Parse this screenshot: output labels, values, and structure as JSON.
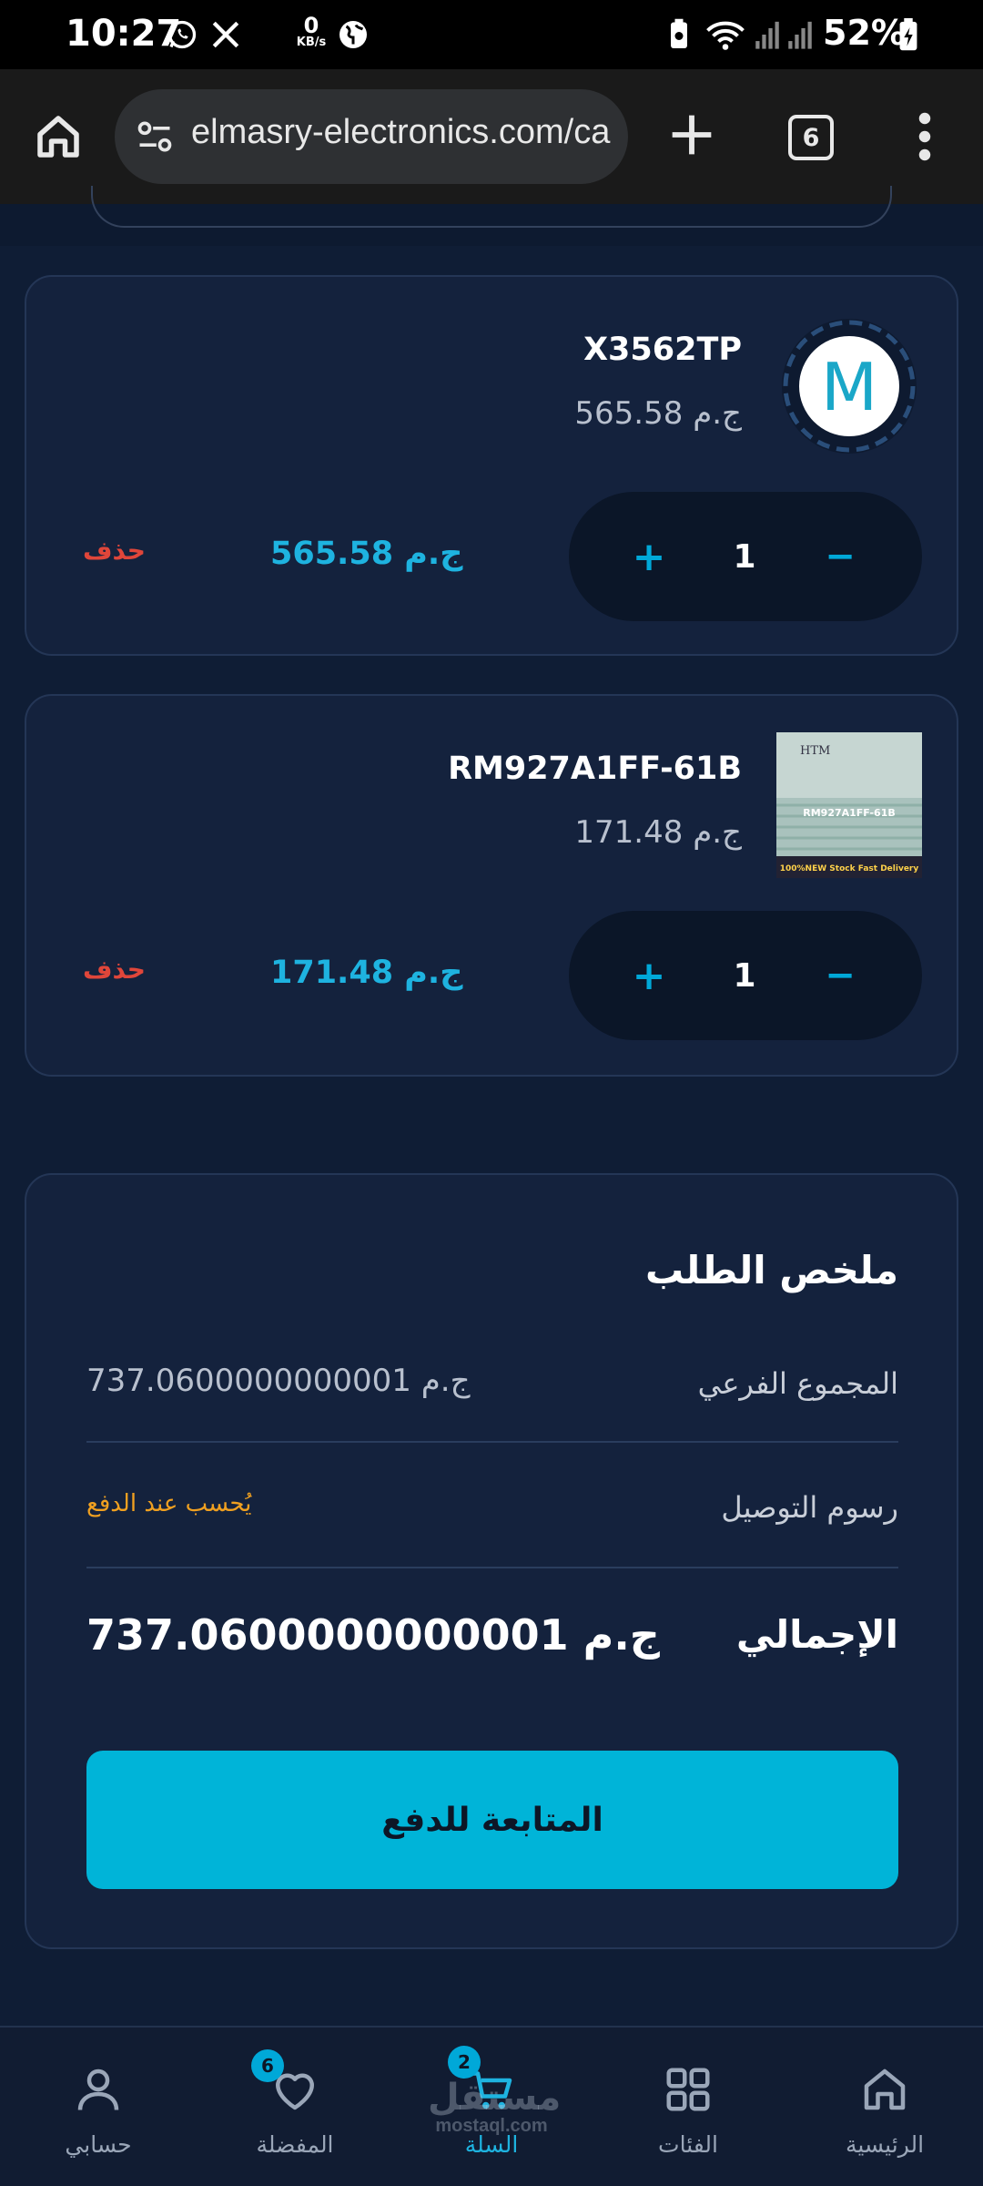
{
  "status_bar": {
    "time": "10:27",
    "net_speed_value": "0",
    "net_speed_unit": "KB/s",
    "battery": "52%"
  },
  "browser": {
    "url": "elmasry-electronics.com/ca",
    "tab_count": "6"
  },
  "cart": {
    "items": [
      {
        "name": "X3562TP",
        "unit_price": "565.58 ج.م",
        "quantity": "1",
        "plus": "+",
        "minus": "−",
        "line_total": "565.58 ج.م",
        "delete_label": "حذف",
        "thumb_letter": "M"
      },
      {
        "name": "RM927A1FF-61B",
        "unit_price": "171.48 ج.م",
        "quantity": "1",
        "plus": "+",
        "minus": "−",
        "line_total": "171.48 ج.م",
        "delete_label": "حذف",
        "thumb_lines": [
          "HTM",
          "RM927A1FF-61B",
          "100%NEW Stock Fast Delivery"
        ]
      }
    ]
  },
  "summary": {
    "title": "ملخص الطلب",
    "subtotal_label": "المجموع الفرعي",
    "subtotal_value": "737.0600000000001 ج.م",
    "shipping_label": "رسوم التوصيل",
    "shipping_value": "يُحسب عند الدفع",
    "total_label": "الإجمالي",
    "total_value": "737.0600000000001 ج.م",
    "checkout_label": "المتابعة للدفع"
  },
  "bottom_nav": {
    "items": [
      {
        "label": "حسابي",
        "icon": "user-icon"
      },
      {
        "label": "المفضلة",
        "icon": "heart-icon",
        "badge": "6"
      },
      {
        "label": "السلة",
        "icon": "cart-icon",
        "badge": "2",
        "active": true
      },
      {
        "label": "الفئات",
        "icon": "grid-icon"
      },
      {
        "label": "الرئيسية",
        "icon": "home-icon"
      }
    ]
  },
  "watermark": {
    "arabic": "مستقل",
    "latin": "mostaql.com"
  },
  "colors": {
    "background": "#0f1d35",
    "card": "#14223d",
    "accent": "#00b4d8",
    "price": "#1eb3e0",
    "delete": "#e0463a",
    "note": "#f0a020"
  }
}
